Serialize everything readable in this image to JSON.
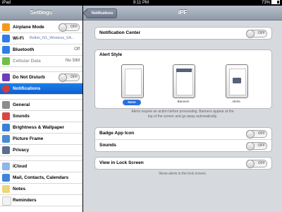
{
  "status": {
    "left": "iPad",
    "time": "9:11 PM",
    "battery": "73%"
  },
  "master": {
    "title": "Settings",
    "rows": [
      {
        "label": "Airplane Mode",
        "switch": "OFF"
      },
      {
        "label": "Wi-Fi",
        "value": "Belkin_N1_Wireless_5A..."
      },
      {
        "label": "Bluetooth",
        "value": "Off"
      },
      {
        "label": "Cellular Data",
        "value": "No SIM"
      },
      {
        "label": "Do Not Disturb",
        "switch": "OFF"
      },
      {
        "label": "Notifications"
      },
      {
        "label": "General"
      },
      {
        "label": "Sounds"
      },
      {
        "label": "Brightness & Wallpaper"
      },
      {
        "label": "Picture Frame"
      },
      {
        "label": "Privacy"
      },
      {
        "label": "iCloud"
      },
      {
        "label": "Mail, Contacts, Calendars"
      },
      {
        "label": "Notes"
      },
      {
        "label": "Reminders"
      }
    ]
  },
  "detail": {
    "back": "Notifications",
    "title": "iPF",
    "notification_center": {
      "label": "Notification Center",
      "switch": "OFF"
    },
    "alert_style": {
      "title": "Alert Style",
      "options": [
        {
          "label": "None"
        },
        {
          "label": "Banners"
        },
        {
          "label": "Alerts"
        }
      ],
      "note": "Alerts require an action before proceeding. Banners appear at the top of the screen and go away automatically."
    },
    "badge": {
      "label": "Badge App Icon",
      "switch": "OFF"
    },
    "sounds": {
      "label": "Sounds",
      "switch": "OFF"
    },
    "lock_screen": {
      "label": "View in Lock Screen",
      "switch": "OFF",
      "note": "Show alerts in the lock screen."
    }
  }
}
